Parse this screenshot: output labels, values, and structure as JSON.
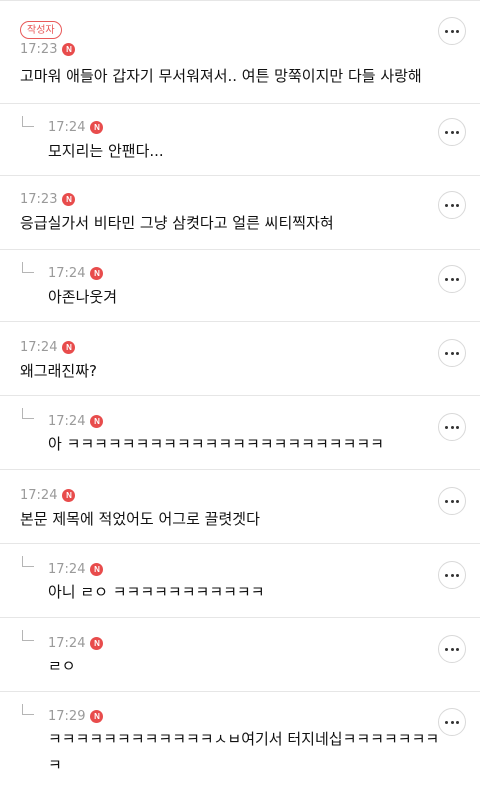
{
  "comments": [
    {
      "badge": "작성자",
      "time": "17:23",
      "n_label": "N",
      "text": "고마워 애들아 갑자기 무서워져서.. 여튼 망쭉이지만 다들 사랑해",
      "reply": false
    },
    {
      "time": "17:24",
      "n_label": "N",
      "text": "모지리는 안팬다...",
      "reply": true
    },
    {
      "time": "17:23",
      "n_label": "N",
      "text": "응급실가서 비타민 그냥 삼켯다고 얼른 씨티찍자혀",
      "reply": false
    },
    {
      "time": "17:24",
      "n_label": "N",
      "text": "아존나웃겨",
      "reply": true
    },
    {
      "time": "17:24",
      "n_label": "N",
      "text": "왜그래진짜?",
      "reply": false
    },
    {
      "time": "17:24",
      "n_label": "N",
      "text": "아 ㅋㅋㅋㅋㅋㅋㅋㅋㅋㅋㅋㅋㅋㅋㅋㅋㅋㅋㅋㅋㅋㅋㅋ",
      "reply": true
    },
    {
      "time": "17:24",
      "n_label": "N",
      "text": "본문 제목에 적었어도 어그로 끌렷겟다",
      "reply": false
    },
    {
      "time": "17:24",
      "n_label": "N",
      "text": "아니 ㄹㅇ ㅋㅋㅋㅋㅋㅋㅋㅋㅋㅋㅋ",
      "reply": true
    },
    {
      "time": "17:24",
      "n_label": "N",
      "text": "ㄹㅇ",
      "reply": true
    },
    {
      "time": "17:29",
      "n_label": "N",
      "text": "ㅋㅋㅋㅋㅋㅋㅋㅋㅋㅋㅋㅋㅅㅂ여기서 터지네십ㅋㅋㅋㅋㅋㅋㅋ\nㅋ",
      "reply": true
    }
  ]
}
